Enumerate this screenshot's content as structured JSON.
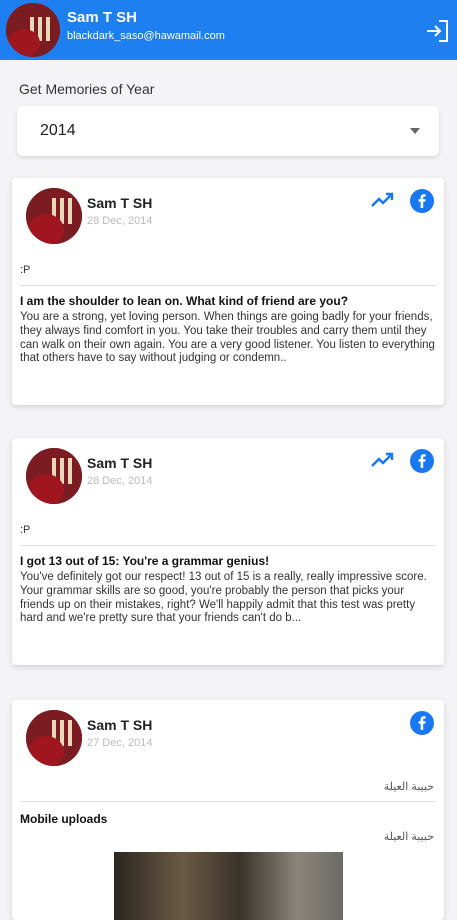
{
  "header": {
    "name": "Sam T SH",
    "email": "blackdark_saso@hawamail.com"
  },
  "year_picker": {
    "label": "Get Memories of Year",
    "selected": "2014"
  },
  "posts": [
    {
      "author": "Sam T SH",
      "date": "28 Dec, 2014",
      "mood": ":P",
      "title": "I am the shoulder to lean on. What kind of friend are you?",
      "body": "You are a strong, yet loving person. When things are going badly for your friends, they always find comfort in you. You take their troubles and carry them until they can walk on their own again. You are a very good listener. You listen to everything that others have to say without judging or condemn..",
      "icons": [
        "trending-up-icon",
        "facebook-icon"
      ]
    },
    {
      "author": "Sam T SH",
      "date": "28 Dec, 2014",
      "mood": ":P",
      "title": "I got 13 out of 15: You're a grammar genius!",
      "body": "You've definitely got our respect! 13 out of 15 is a really, really impressive score. Your grammar skills are so good, you're probably the person that picks your friends up on their mistakes, right? We'll happily admit that this test was pretty hard and we're pretty sure that your friends can't do b...",
      "icons": [
        "trending-up-icon",
        "facebook-icon"
      ]
    },
    {
      "author": "Sam T SH",
      "date": "27 Dec, 2014",
      "arabic_top": "حبيبة العيلة",
      "title": "Mobile uploads",
      "arabic_caption": "حبيبة العيلة",
      "icons": [
        "facebook-icon"
      ]
    }
  ],
  "colors": {
    "header": "#1e7ff0",
    "accent": "#1877f2"
  }
}
